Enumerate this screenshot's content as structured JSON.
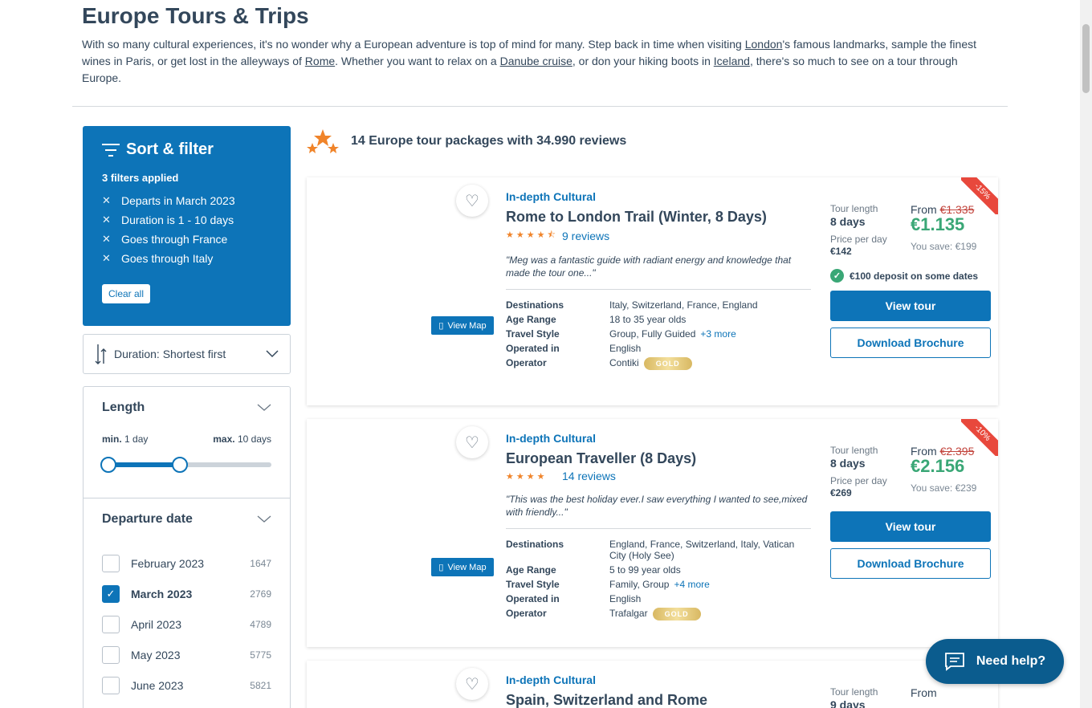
{
  "page": {
    "title": "Europe Tours & Trips",
    "intro": {
      "t1": "With so many cultural experiences, it's no wonder why a European adventure is top of mind for many. Step back in time when visiting ",
      "l1": "London",
      "t2": "'s famous landmarks, sample the finest wines in Paris, or get lost in the alleyways of ",
      "l2": "Rome",
      "t3": ". Whether you want to relax on a ",
      "l3": "Danube cruise",
      "t4": ", or don your hiking boots in ",
      "l4": "Iceland",
      "t5": ", there's so much to see on a tour through Europe."
    }
  },
  "filters": {
    "title": "Sort & filter",
    "applied": "3 filters applied",
    "items": [
      "Departs in March 2023",
      "Duration is 1 - 10 days",
      "Goes through France",
      "Goes through Italy"
    ],
    "clear": "Clear all"
  },
  "sort": {
    "label": "Duration: Shortest first"
  },
  "length": {
    "title": "Length",
    "min_label": "min.",
    "min_value": "1 day",
    "max_label": "max.",
    "max_value": "10 days",
    "range_min": 1,
    "range_max": 10
  },
  "departure": {
    "title": "Departure date",
    "months": [
      {
        "name": "February 2023",
        "count": "1647",
        "checked": false
      },
      {
        "name": "March 2023",
        "count": "2769",
        "checked": true
      },
      {
        "name": "April 2023",
        "count": "4789",
        "checked": false
      },
      {
        "name": "May 2023",
        "count": "5775",
        "checked": false
      },
      {
        "name": "June 2023",
        "count": "5821",
        "checked": false
      }
    ]
  },
  "results": {
    "heading": "14 Europe tour packages with 34.990 reviews"
  },
  "tours": [
    {
      "style": "In-depth Cultural",
      "name": "Rome to London Trail (Winter, 8 Days)",
      "stars": 4.5,
      "reviews": "9 reviews",
      "quote": "\"Meg was a fantastic guide with radiant energy and knowledge that made the tour one...\"",
      "destinations": "Italy, Switzerland, France, England",
      "age": "18 to 35 year olds",
      "travel_style": "Group, Fully Guided",
      "travel_more": "+3 more",
      "language": "English",
      "operator": "Contiki",
      "badge": "GOLD",
      "discount": "-15%",
      "tour_length": "8 days",
      "ppd": "€142",
      "old_price": "€1.335",
      "price": "€1.135",
      "save": "You save: €199",
      "deposit": "€100 deposit on some dates"
    },
    {
      "style": "In-depth Cultural",
      "name": "European Traveller (8 Days)",
      "stars": 4,
      "reviews": "14 reviews",
      "quote": "\"This was the best holiday ever.I saw everything I wanted to see,mixed with friendly...\"",
      "destinations": "England, France, Switzerland, Italy, Vatican City (Holy See)",
      "age": "5 to 99 year olds",
      "travel_style": "Family, Group",
      "travel_more": "+4 more",
      "language": "English",
      "operator": "Trafalgar",
      "badge": "GOLD",
      "discount": "-10%",
      "tour_length": "8 days",
      "ppd": "€269",
      "old_price": "€2.395",
      "price": "€2.156",
      "save": "You save: €239"
    },
    {
      "style": "In-depth Cultural",
      "name": "Spain, Switzerland and Rome",
      "tour_length": "9 days"
    }
  ],
  "labels": {
    "destinations": "Destinations",
    "age": "Age Range",
    "travel_style": "Travel Style",
    "operated": "Operated in",
    "operator": "Operator",
    "tour_length": "Tour length",
    "ppd": "Price per day",
    "from": "From",
    "view_tour": "View tour",
    "download": "Download Brochure",
    "view_map": "View Map"
  },
  "help": {
    "label": "Need help?"
  },
  "colors": {
    "brand": "#0d74b8",
    "price": "#3aa776",
    "discount": "#e8483c",
    "stars": "#f0842a"
  }
}
